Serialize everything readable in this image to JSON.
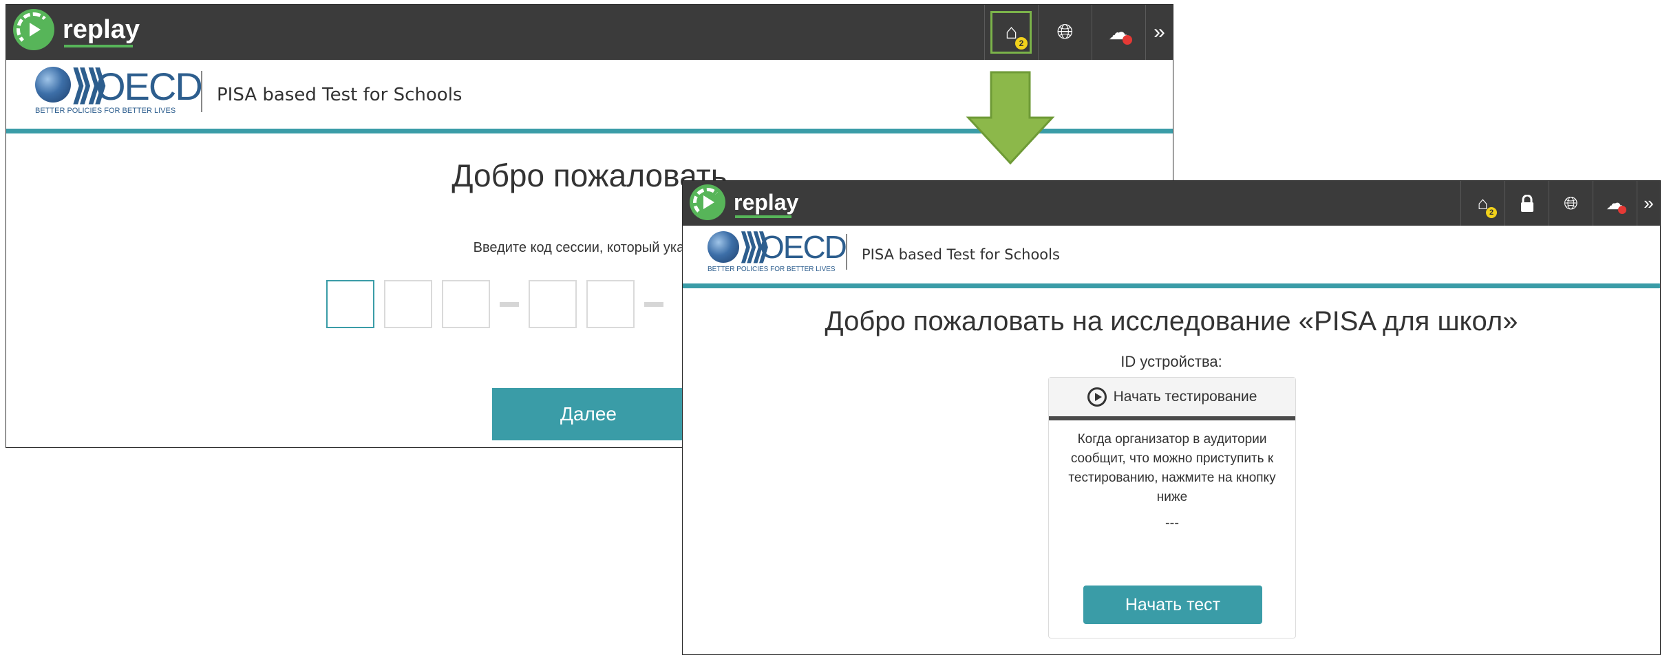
{
  "back_window": {
    "brand": "replay",
    "toolbar": {
      "home_badge": "2",
      "home_icon": "home-icon",
      "globe_icon": "globe-icon",
      "cloud_icon": "cloud-icon",
      "expand_label": "»"
    },
    "app_title": "PISA based Test for Schools",
    "oecd": {
      "word": "OECD",
      "tagline": "BETTER POLICIES FOR BETTER LIVES"
    },
    "welcome": "Добро пожаловать",
    "instruction": "Введите код сессии, который указан",
    "next_label": "Далее"
  },
  "front_window": {
    "brand": "replay",
    "toolbar": {
      "home_badge": "2",
      "home_icon": "home-icon",
      "lock_icon": "lock-icon",
      "globe_icon": "globe-icon",
      "cloud_icon": "cloud-icon",
      "expand_label": "»"
    },
    "app_title": "PISA based Test for Schools",
    "oecd": {
      "word": "OECD",
      "tagline": "BETTER POLICIES FOR BETTER LIVES"
    },
    "welcome": "Добро пожаловать на исследование «PISA для школ»",
    "device_id_label": "ID устройства:",
    "card": {
      "header": "Начать тестирование",
      "text": "Когда организатор в аудитории сообщит, что можно приступить к тестированию, нажмите на кнопку ниже",
      "placeholder": "---",
      "start_label": "Начать тест"
    }
  },
  "colors": {
    "topbar": "#3b3b3b",
    "accent_teal": "#3a9ca7",
    "arrow_green": "#8cb84a",
    "badge_yellow": "#f2d21b",
    "record_red": "#e53935"
  }
}
